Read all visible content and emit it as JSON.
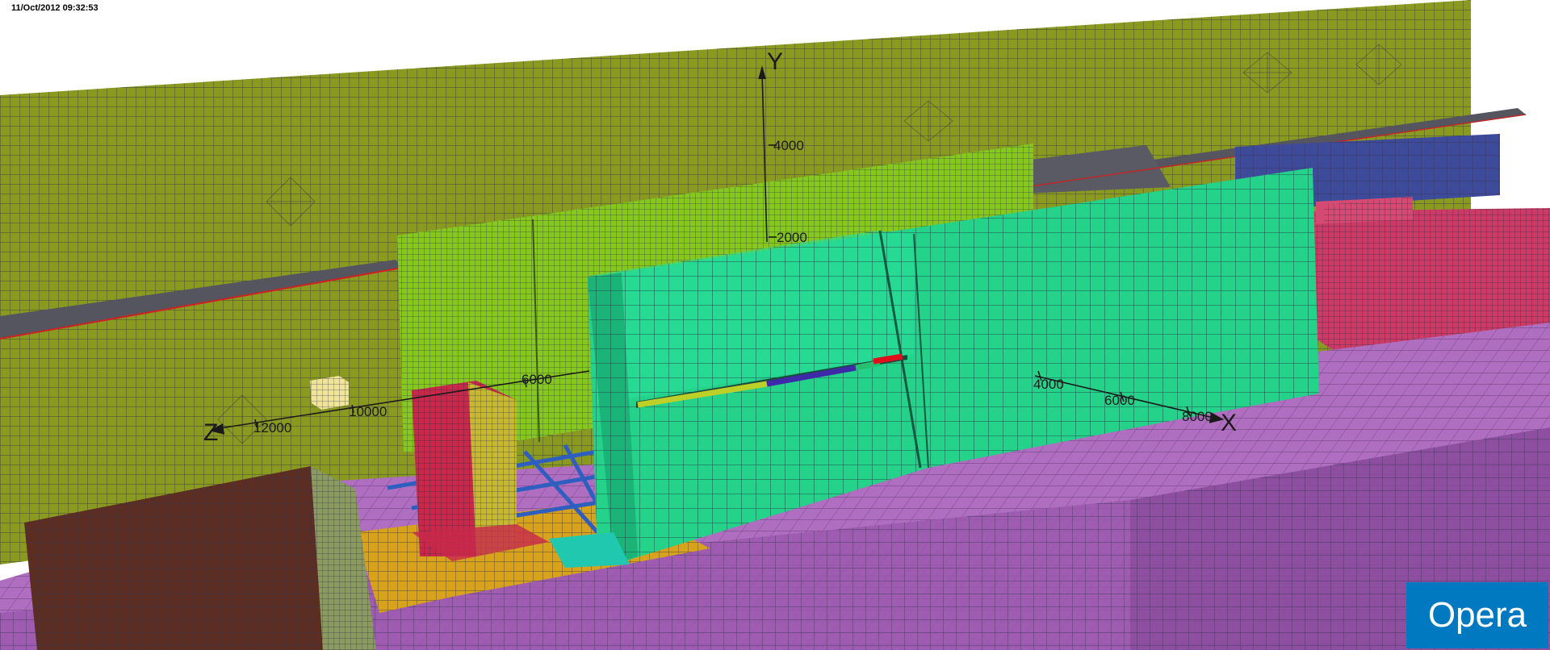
{
  "header": {
    "timestamp": "11/Oct/2012 09:32:53"
  },
  "branding": {
    "logo_text": "Opera"
  },
  "axes": {
    "y_label": "Y",
    "x_label": "X",
    "z_label": "Z",
    "y_ticks": [
      "4000",
      "2000"
    ],
    "x_ticks": [
      "4000",
      "6000",
      "8000"
    ],
    "z_ticks": [
      "12000",
      "10000",
      "6000"
    ]
  },
  "colors": {
    "back_wall": "#8a9a1e",
    "inner_panel": "#86c81f",
    "front_panel": "#24d28a",
    "floor": "#b06ec0",
    "right_block": "#cc3a66",
    "blue_slab": "#3e4a9a",
    "gray_shelf": "#555560",
    "brown_panel": "#5c2e22",
    "yellow_base": "#d8a21a",
    "red_box": "#c8284a",
    "logo": "#0079c1"
  }
}
